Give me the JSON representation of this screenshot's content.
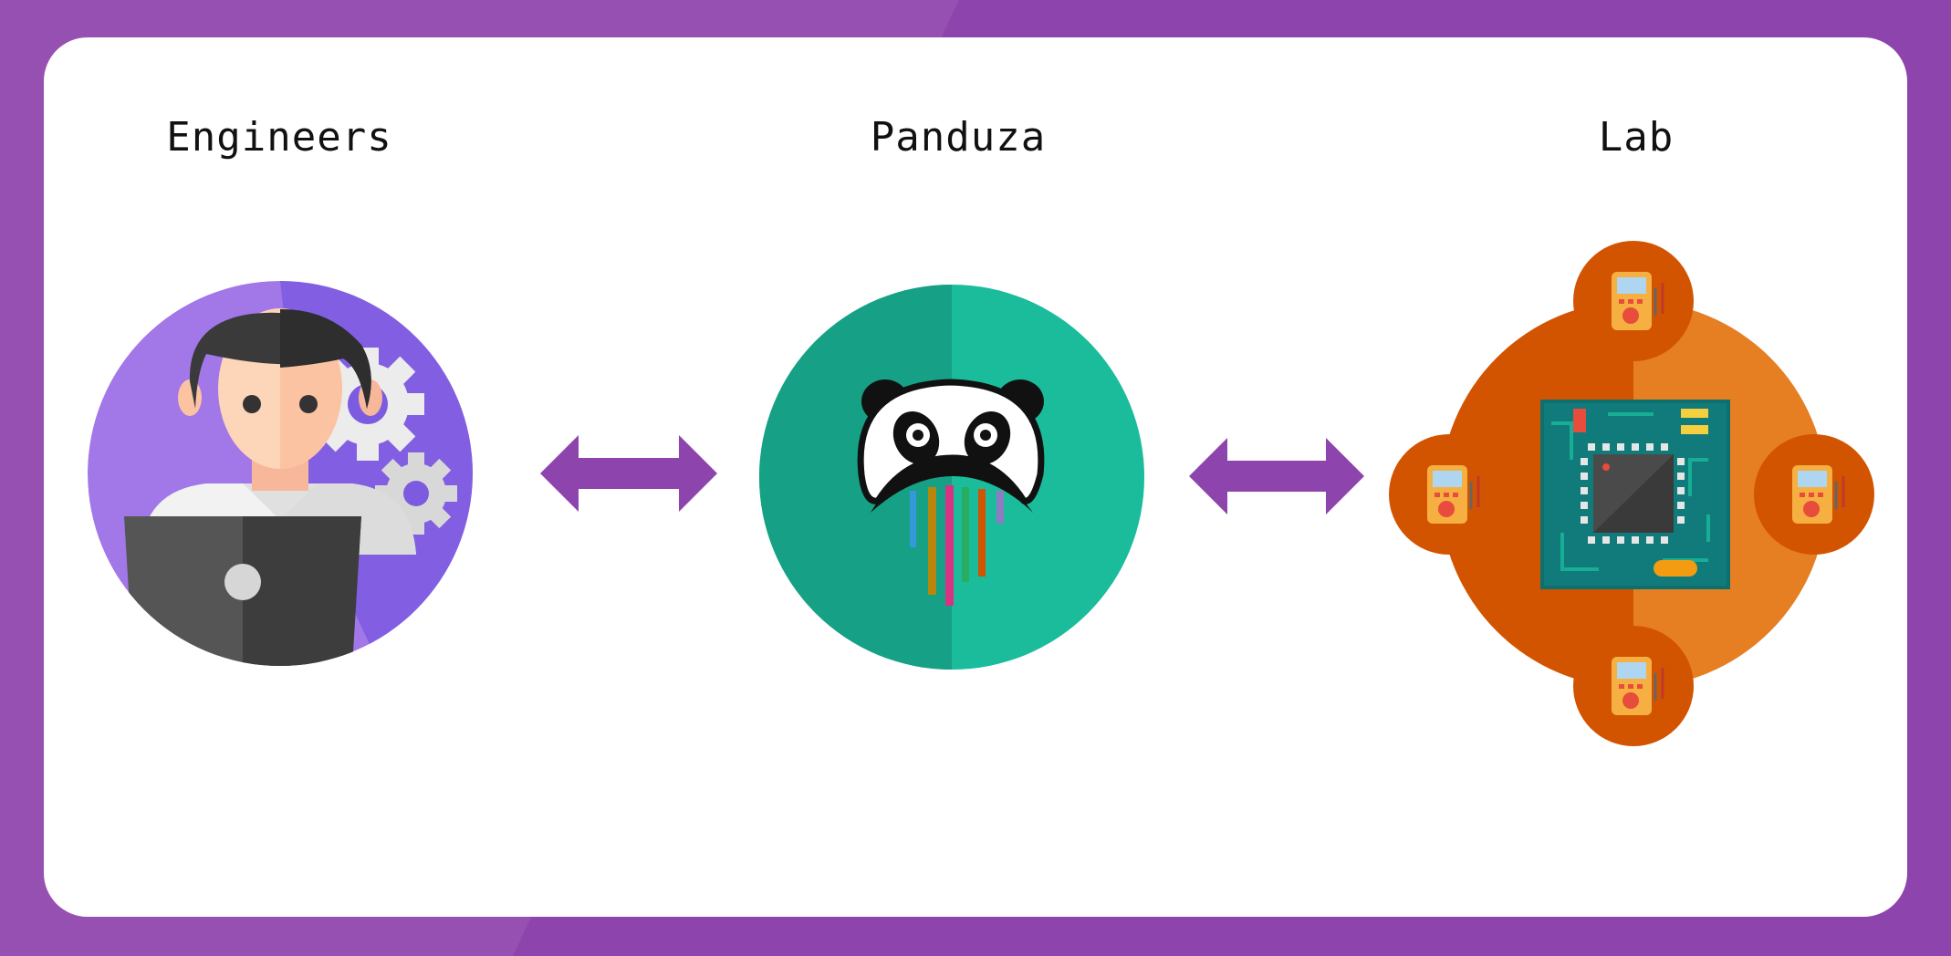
{
  "nodes": [
    {
      "label": "Engineers",
      "icon": "engineer-at-laptop-icon"
    },
    {
      "label": "Panduza",
      "icon": "panda-logo-icon"
    },
    {
      "label": "Lab",
      "icon": "circuit-board-with-multimeters-icon"
    }
  ],
  "connectors": [
    {
      "from": "Engineers",
      "to": "Panduza",
      "type": "bidirectional-arrow"
    },
    {
      "from": "Panduza",
      "to": "Lab",
      "type": "bidirectional-arrow"
    }
  ],
  "colors": {
    "background": "#8e44ad",
    "card": "#ffffff",
    "arrow": "#8e44ad",
    "engineer_circle": "#a277e8",
    "panduza_circle": "#1abc9c",
    "lab_circle": "#e67e22"
  }
}
